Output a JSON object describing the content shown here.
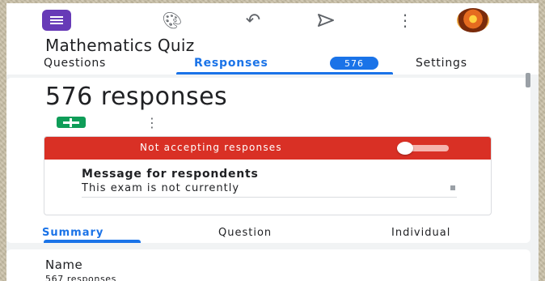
{
  "header": {
    "form_title": "Mathematics Quiz",
    "icons": [
      "forms-logo-icon",
      "palette-icon",
      "undo-icon",
      "send-icon",
      "more-vert-icon",
      "avatar"
    ]
  },
  "tabs": {
    "questions": "Questions",
    "responses": "Responses",
    "responses_badge": "576",
    "settings": "Settings"
  },
  "summary_card": {
    "response_count_text": "576 responses",
    "accepting": {
      "label": "Not accepting responses",
      "enabled": false
    },
    "message_label": "Message for respondents",
    "message_value": "This exam is not currently"
  },
  "sub_tabs": {
    "summary": "Summary",
    "question": "Question",
    "individual": "Individual"
  },
  "name_card": {
    "title": "Name",
    "count": "567 responses"
  },
  "colors": {
    "accent": "#1a73e8",
    "forms_purple": "#673ab7",
    "sheets_green": "#0f9d58",
    "alert_red": "#d93025"
  }
}
